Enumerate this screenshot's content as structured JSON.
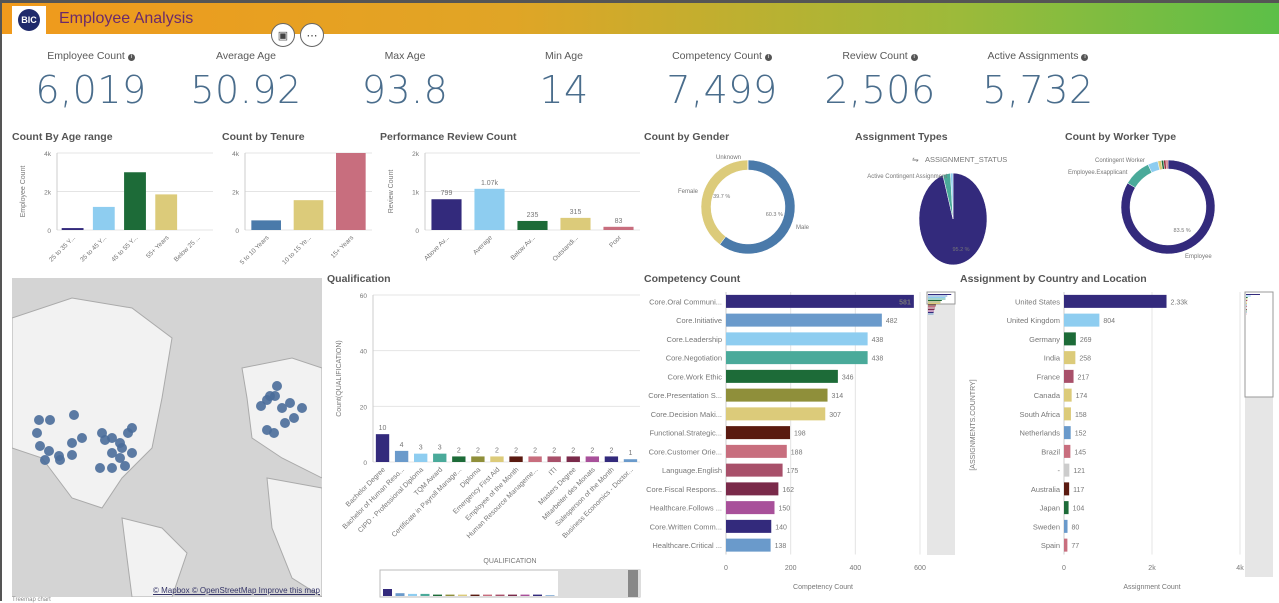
{
  "app": {
    "title": "Employee Analysis",
    "logo_text": "BIC",
    "icons": [
      "camera-icon",
      "expand-icon"
    ]
  },
  "kpis": [
    {
      "label": "Employee Count",
      "value": "6,019",
      "info": true
    },
    {
      "label": "Average Age",
      "value": "50.92",
      "info": false
    },
    {
      "label": "Max Age",
      "value": "93.8",
      "info": false
    },
    {
      "label": "Min Age",
      "value": "14",
      "info": false
    },
    {
      "label": "Competency Count",
      "value": "7,499",
      "info": true
    },
    {
      "label": "Review Count",
      "value": "2,506",
      "info": true
    },
    {
      "label": "Active Assignments",
      "value": "5,732",
      "info": true
    }
  ],
  "map": {
    "attribution": "© Mapbox © OpenStreetMap Improve this map",
    "footer": "Treemap chart"
  },
  "chart_data": [
    {
      "id": "age",
      "type": "bar",
      "title": "Count By Age range",
      "ylabel": "Employee Count",
      "ylim": [
        0,
        4000
      ],
      "yticks": [
        "0",
        "2k",
        "4k"
      ],
      "categories": [
        "25 to 35 Y...",
        "35 to 45 Y...",
        "45 to 55 Y...",
        "55+ Years",
        "Below 25 ..."
      ],
      "values": [
        100,
        1200,
        3000,
        1850,
        0
      ],
      "colors": [
        "#332a7c",
        "#8ecdf0",
        "#1d6b38",
        "#dccb7a",
        "#cccccc"
      ],
      "labels": false
    },
    {
      "id": "tenure",
      "type": "bar",
      "title": "Count by Tenure",
      "ylabel": "",
      "ylim": [
        0,
        4000
      ],
      "yticks": [
        "0",
        "2k",
        "4k"
      ],
      "categories": [
        "5 to 10 Years",
        "10 to 15 Ye...",
        "15+ Years"
      ],
      "values": [
        500,
        1550,
        4100
      ],
      "colors": [
        "#4a7aaa",
        "#dccb7a",
        "#c86e7e"
      ],
      "labels": false
    },
    {
      "id": "review",
      "type": "bar",
      "title": "Performance Review Count",
      "ylabel": "Review Count",
      "ylim": [
        0,
        2000
      ],
      "yticks": [
        "0",
        "1k",
        "2k"
      ],
      "categories": [
        "Above Av...",
        "Average",
        "Below Av...",
        "Outstandi...",
        "Poor"
      ],
      "values": [
        799,
        1070,
        235,
        315,
        83
      ],
      "value_labels": [
        "799",
        "1.07k",
        "235",
        "315",
        "83"
      ],
      "colors": [
        "#332a7c",
        "#8ecdf0",
        "#1d6b38",
        "#dccb7a",
        "#c86e7e"
      ],
      "labels": true
    },
    {
      "id": "gender",
      "type": "pie",
      "title": "Count by Gender",
      "donut": true,
      "slices": [
        {
          "name": "Male",
          "value": 60.3,
          "label": "60.3 %",
          "color": "#4a7aaa"
        },
        {
          "name": "Female",
          "value": 39.7,
          "label": "39.7 %",
          "color": "#dccb7a"
        },
        {
          "name": "Unknown",
          "value": 0.05,
          "label": "",
          "color": "#aaaaaa"
        }
      ]
    },
    {
      "id": "assign",
      "type": "pie",
      "title": "Assignment Types",
      "donut": false,
      "legend_title": "ASSIGNMENT_STATUS",
      "slices": [
        {
          "name": "",
          "value": 95.2,
          "label": "95.2 %",
          "color": "#332a7c"
        },
        {
          "name": "Active Contingent Assignment",
          "value": 3.6,
          "label": "",
          "color": "#4aaa9a"
        },
        {
          "name": "",
          "value": 1.2,
          "label": "",
          "color": "#8ecdf0"
        }
      ]
    },
    {
      "id": "worker",
      "type": "pie",
      "title": "Count by Worker Type",
      "donut": true,
      "slices": [
        {
          "name": "Employee",
          "value": 83.5,
          "label": "83.5 %",
          "color": "#332a7c"
        },
        {
          "name": "Employee.Exapplicant",
          "value": 9.5,
          "label": "",
          "color": "#4aaa9a"
        },
        {
          "name": "",
          "value": 3.5,
          "label": "",
          "color": "#8ecdf0"
        },
        {
          "name": "Contingent Worker",
          "value": 1.2,
          "label": "",
          "color": "#dccb7a"
        },
        {
          "name": "",
          "value": 0.8,
          "label": "",
          "color": "#1d6b38"
        },
        {
          "name": "",
          "value": 0.8,
          "label": "",
          "color": "#9a2a3a"
        },
        {
          "name": "",
          "value": 0.7,
          "label": "",
          "color": "#c86e7e"
        }
      ]
    },
    {
      "id": "qual",
      "type": "bar",
      "title": "Qualification",
      "ylabel": "Count(QUALIFICATION)",
      "xlabel": "QUALIFICATION",
      "ylim": [
        0,
        60
      ],
      "yticks": [
        "0",
        "20",
        "40",
        "60"
      ],
      "categories": [
        "Bachelor Degree",
        "Bachelor of Human Reso...",
        "CIPD - Professional Diploma",
        "TQM Award",
        "Certificate in Payroll Manage...",
        "Diploma",
        "Emergency First Aid",
        "Employee of the Month",
        "Human Resource Manageme...",
        "ITI",
        "Masters Degree",
        "Mitarbeiter des Monats",
        "Salesperson of the Month",
        "Business Economics - Doctor..."
      ],
      "values": [
        10,
        4,
        3,
        3,
        2,
        2,
        2,
        2,
        2,
        2,
        2,
        2,
        2,
        1
      ],
      "colors": [
        "#332a7c",
        "#6a9acb",
        "#8ecdf0",
        "#4aaa9a",
        "#1d6b38",
        "#8f8f3a",
        "#dccb7a",
        "#5a1a10",
        "#c86e7e",
        "#a8506a",
        "#7a2a4a",
        "#a8509a",
        "#332a7c",
        "#6a9acb"
      ],
      "labels": true
    },
    {
      "id": "comp",
      "type": "hbar",
      "title": "Competency Count",
      "xlabel": "Competency Count",
      "xlim": [
        0,
        600
      ],
      "xticks": [
        "0",
        "200",
        "400",
        "600"
      ],
      "categories": [
        "Core.Oral Communi...",
        "Core.Initiative",
        "Core.Leadership",
        "Core.Negotiation",
        "Core.Work Ethic",
        "Core.Presentation S...",
        "Core.Decision Maki...",
        "Functional.Strategic...",
        "Core.Customer Orie...",
        "Language.English",
        "Core.Fiscal Respons...",
        "Healthcare.Follows ...",
        "Core.Written Comm...",
        "Healthcare.Critical ..."
      ],
      "values": [
        581,
        482,
        438,
        438,
        346,
        314,
        307,
        198,
        188,
        175,
        162,
        150,
        140,
        138
      ],
      "value_labels": [
        "581",
        "482",
        "438",
        "438",
        "346",
        "314",
        "307",
        "198",
        "188",
        "175",
        "162",
        "150",
        "140",
        "138"
      ],
      "colors": [
        "#332a7c",
        "#6a9acb",
        "#8ecdf0",
        "#4aaa9a",
        "#1d6b38",
        "#8f8f3a",
        "#dccb7a",
        "#5a1a10",
        "#c86e7e",
        "#a8506a",
        "#7a2a4a",
        "#a8509a",
        "#332a7c",
        "#6a9acb"
      ]
    },
    {
      "id": "country",
      "type": "hbar",
      "title": "Assignment by Country and Location",
      "ylabel": "[ASSIGNMENTS.COUNTRY]",
      "xlabel": "Assignment Count",
      "xlim": [
        0,
        4000
      ],
      "xticks": [
        "0",
        "2k",
        "4k"
      ],
      "categories": [
        "United States",
        "United Kingdom",
        "Germany",
        "India",
        "France",
        "Canada",
        "South Africa",
        "Netherlands",
        "Brazil",
        "-",
        "Australia",
        "Japan",
        "Sweden",
        "Spain"
      ],
      "values": [
        2330,
        804,
        269,
        258,
        217,
        174,
        158,
        152,
        145,
        121,
        117,
        104,
        80,
        77
      ],
      "value_labels": [
        "2.33k",
        "804",
        "269",
        "258",
        "217",
        "174",
        "158",
        "152",
        "145",
        "121",
        "117",
        "104",
        "80",
        "77"
      ],
      "colors": [
        "#332a7c",
        "#8ecdf0",
        "#1d6b38",
        "#dccb7a",
        "#a8506a",
        "#dccb7a",
        "#dccb7a",
        "#6a9acb",
        "#c86e7e",
        "#cccccc",
        "#5a1a10",
        "#1d6b38",
        "#6a9acb",
        "#c86e7e"
      ]
    }
  ]
}
